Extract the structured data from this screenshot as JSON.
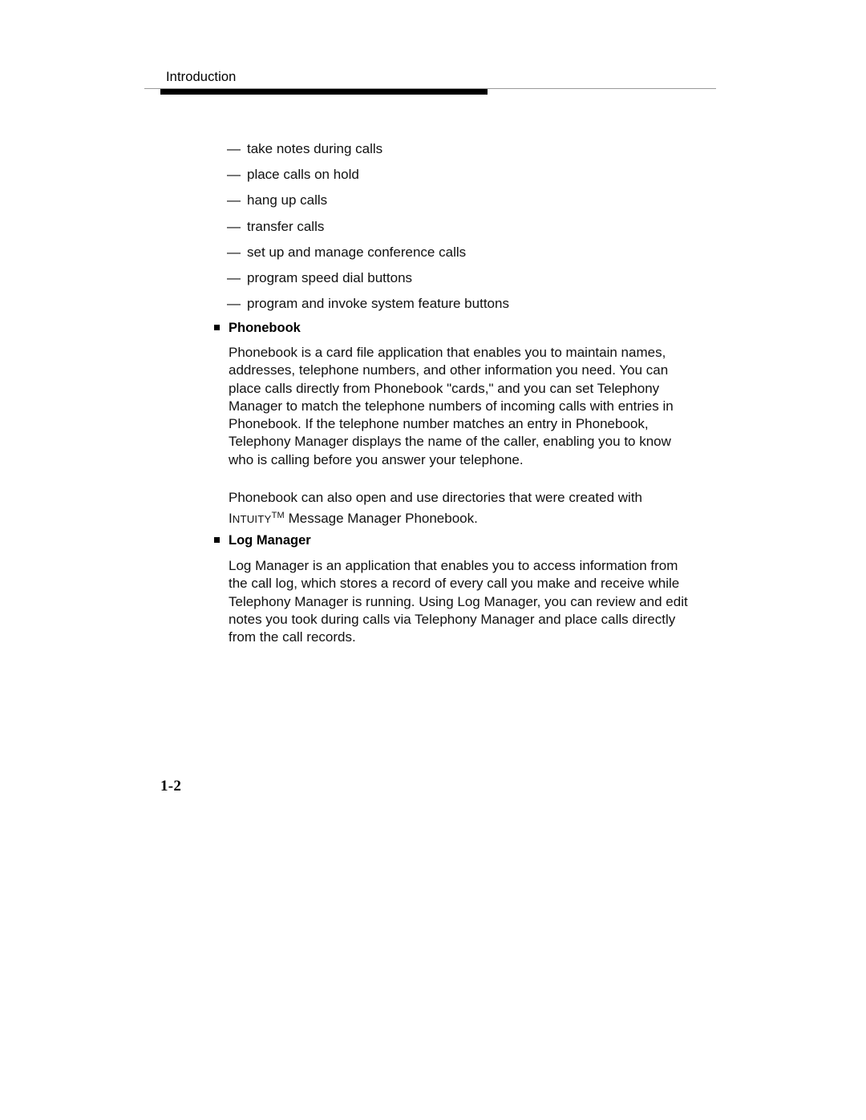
{
  "header": {
    "title": "Introduction"
  },
  "dash_list": {
    "marker": "—",
    "items": [
      "take notes during calls",
      "place calls on hold",
      "hang up calls",
      "transfer calls",
      "set up and manage conference calls",
      "program speed dial buttons",
      "program and invoke system feature buttons"
    ]
  },
  "sections": [
    {
      "heading": "Phonebook",
      "paragraphs": [
        "Phonebook is a card file application that enables you to maintain names, addresses, telephone numbers, and other information you need. You can place calls directly from Phonebook \"cards,\" and you can set Telephony Manager to match the telephone numbers of incoming calls with entries in Phonebook. If the telephone number matches an entry in Phonebook, Telephony Manager displays the name of the caller, enabling you to know who is calling before you answer your telephone."
      ],
      "paragraph_2_lead": "Phonebook can also open and use directories that were created with ",
      "paragraph_2_brand_first": "I",
      "paragraph_2_brand_rest": "NTUITY",
      "paragraph_2_trademark": "TM",
      "paragraph_2_tail": " Message Manager Phonebook."
    },
    {
      "heading": "Log Manager",
      "paragraphs": [
        "Log Manager is an application that enables you to access information from the call log, which stores a record of every call you make and receive while Telephony Manager is running. Using Log Manager, you can review and edit notes you took during calls via Telephony Manager and place calls directly from the call records."
      ]
    }
  ],
  "folio": {
    "page_number": "1-2"
  }
}
